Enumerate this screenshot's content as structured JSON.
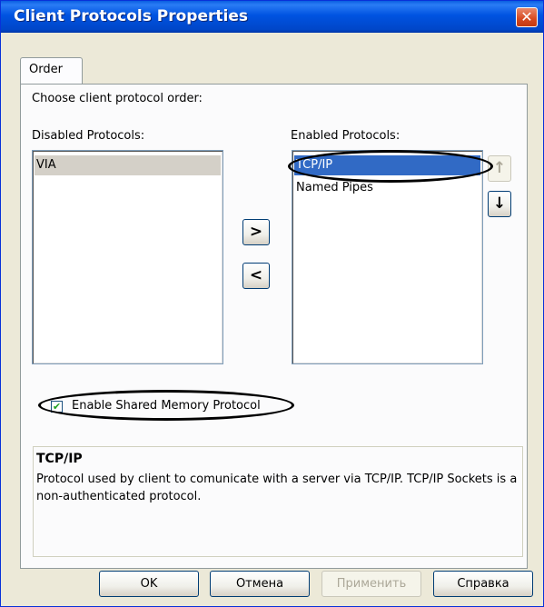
{
  "window": {
    "title": "Client Protocols Properties"
  },
  "tabs": [
    {
      "label": "Order"
    }
  ],
  "order": {
    "instruction": "Choose client protocol order:",
    "disabled_label": "Disabled Protocols:",
    "enabled_label": "Enabled Protocols:",
    "disabled_items": [
      "VIA"
    ],
    "enabled_items": [
      "TCP/IP",
      "Named Pipes"
    ],
    "move_right": ">",
    "move_left": "<",
    "move_up": "↑",
    "move_down": "↓",
    "shared_memory_label": "Enable Shared Memory Protocol",
    "shared_memory_checked": true,
    "description_title": "TCP/IP",
    "description_text": "Protocol used by client to comunicate with a server via TCP/IP. TCP/IP Sockets is a non-authenticated protocol."
  },
  "buttons": {
    "ok": "OK",
    "cancel": "Отмена",
    "apply": "Применить",
    "help": "Справка"
  },
  "colors": {
    "titlebar": "#0053e1",
    "selection": "#316ac5",
    "face": "#ece9d8"
  }
}
